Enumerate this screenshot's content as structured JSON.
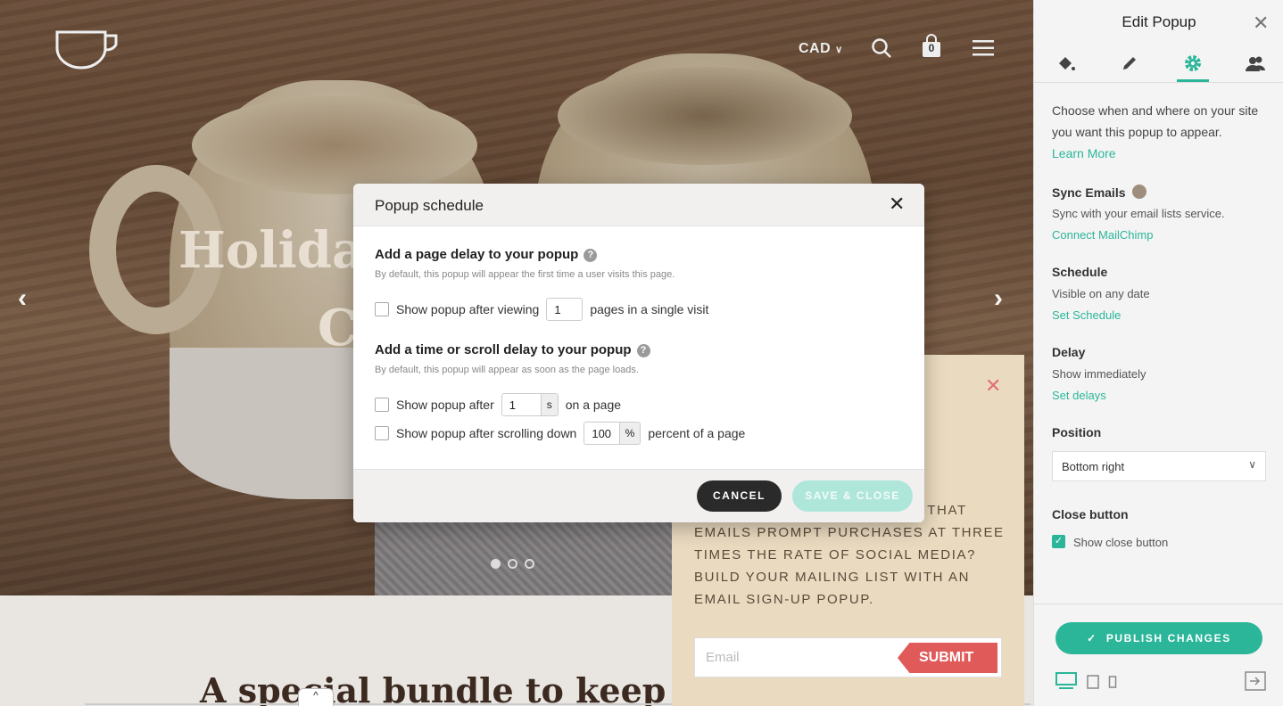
{
  "site": {
    "currency": "CAD",
    "cart_count": "0",
    "hero_title_line1": "Holiday",
    "hero_title_line2": "C",
    "bundle_heading": "A special bundle to keep you warm.",
    "scroll_toggle": "^"
  },
  "promo": {
    "text": "emails prompt purchases at three times the rate of social media? Build your mailing list with an email sign-up popup.",
    "text_prefix": "w that",
    "email_placeholder": "Email",
    "submit_label": "SUBMIT",
    "close_icon": "close-icon"
  },
  "modal": {
    "title": "Popup schedule",
    "section1": {
      "title": "Add a page delay to your popup",
      "description": "By default, this popup will appear the first time a user visits this page.",
      "label_before": "Show popup after viewing",
      "value": "1",
      "label_after": "pages in a single visit"
    },
    "section2": {
      "title": "Add a time or scroll delay to your popup",
      "description": "By default, this popup will appear as soon as the page loads.",
      "time_label_before": "Show popup after",
      "time_value": "1",
      "time_unit": "s",
      "time_label_after": "on a page",
      "scroll_label_before": "Show popup after scrolling down",
      "scroll_value": "100",
      "scroll_unit": "%",
      "scroll_label_after": "percent of a page"
    },
    "cancel_label": "CANCEL",
    "save_label": "SAVE & CLOSE"
  },
  "panel": {
    "title": "Edit Popup",
    "intro": "Choose when and where on your site you want this popup to appear.",
    "learn_more": "Learn More",
    "sync_title": "Sync Emails",
    "sync_text": "Sync with your email lists service.",
    "sync_link": "Connect MailChimp",
    "schedule_title": "Schedule",
    "schedule_text": "Visible on any date",
    "schedule_link": "Set Schedule",
    "delay_title": "Delay",
    "delay_text": "Show immediately",
    "delay_link": "Set delays",
    "position_title": "Position",
    "position_value": "Bottom right",
    "close_title": "Close button",
    "close_check_label": "Show close button",
    "publish_label": "PUBLISH CHANGES"
  },
  "colors": {
    "accent": "#2bb69a",
    "promo_bg": "#eadbc0",
    "submit": "#e05a5a"
  }
}
